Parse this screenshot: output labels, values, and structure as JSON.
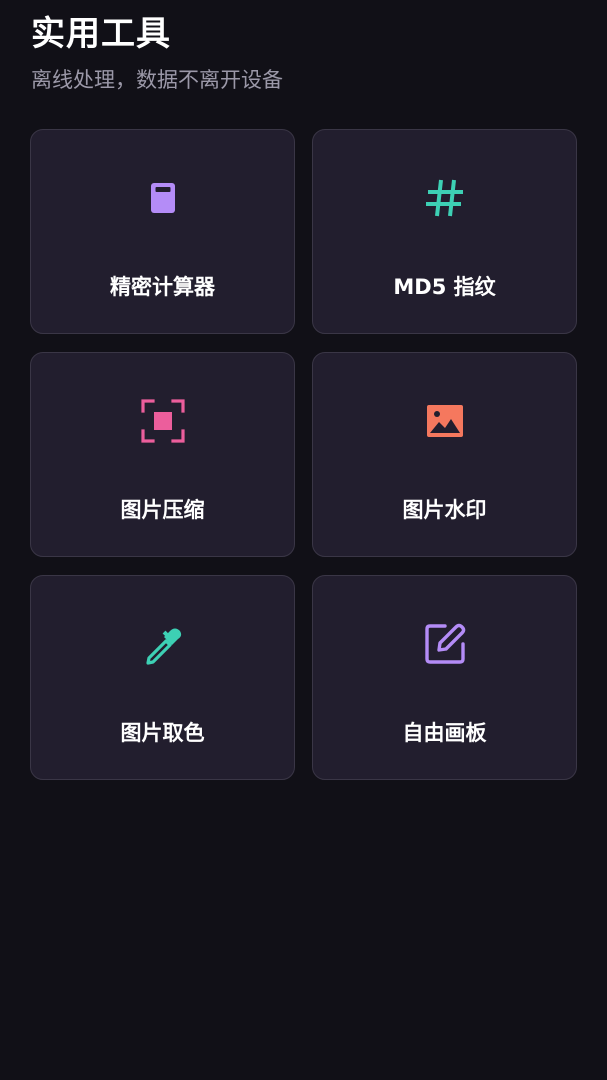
{
  "header": {
    "title": "实用工具",
    "subtitle": "离线处理，数据不离开设备"
  },
  "tools": [
    {
      "label": "精密计算器",
      "icon": "calculator-icon",
      "color": "#b48cf7"
    },
    {
      "label": "MD5 指纹",
      "icon": "hash-icon",
      "color": "#3dd0b4"
    },
    {
      "label": "图片压缩",
      "icon": "compress-icon",
      "color": "#ec5e9c"
    },
    {
      "label": "图片水印",
      "icon": "image-icon",
      "color": "#f5785e"
    },
    {
      "label": "图片取色",
      "icon": "eyedropper-icon",
      "color": "#3dd0b4"
    },
    {
      "label": "自由画板",
      "icon": "edit-icon",
      "color": "#b48cf7"
    }
  ],
  "colors": {
    "background": "#111017",
    "card": "#221e2e",
    "card_border": "#3a3646"
  }
}
